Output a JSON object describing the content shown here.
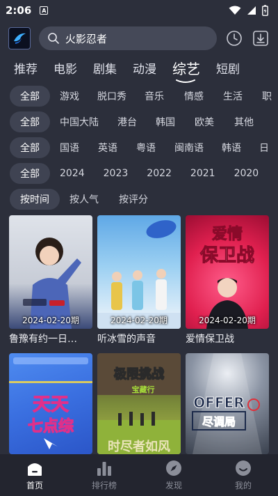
{
  "status": {
    "time": "2:06",
    "a_label": "A"
  },
  "search": {
    "query": "火影忍者"
  },
  "categories": [
    {
      "label": "推荐"
    },
    {
      "label": "电影"
    },
    {
      "label": "剧集"
    },
    {
      "label": "动漫"
    },
    {
      "label": "综艺",
      "active": true
    },
    {
      "label": "短剧"
    }
  ],
  "filters": {
    "type": {
      "selected": "全部",
      "options": [
        "游戏",
        "脱口秀",
        "音乐",
        "情感",
        "生活",
        "职"
      ]
    },
    "region": {
      "selected": "全部",
      "options": [
        "中国大陆",
        "港台",
        "韩国",
        "欧美",
        "其他"
      ]
    },
    "language": {
      "selected": "全部",
      "options": [
        "国语",
        "英语",
        "粤语",
        "闽南语",
        "韩语",
        "日"
      ]
    },
    "year": {
      "selected": "全部",
      "options": [
        "2024",
        "2023",
        "2022",
        "2021",
        "2020"
      ]
    },
    "sort": {
      "selected": "按时间",
      "options": [
        "按人气",
        "按评分"
      ]
    }
  },
  "cards": [
    {
      "title": "鲁豫有约一日…",
      "date": "2024-02-20期",
      "poster_text": ""
    },
    {
      "title": "听冰雪的声音",
      "date": "2024-02-20期",
      "poster_text": ""
    },
    {
      "title": "爱情保卫战",
      "date": "2024-02-20期",
      "poster_text": "爱情 保卫战"
    },
    {
      "title": "",
      "date": "",
      "poster_text": "天天 七点综"
    },
    {
      "title": "",
      "date": "",
      "poster_text": "极限挑战"
    },
    {
      "title": "",
      "date": "",
      "poster_text": "OFFER 尽调局"
    }
  ],
  "nav": [
    {
      "label": "首页",
      "icon": "home-icon",
      "active": true
    },
    {
      "label": "排行榜",
      "icon": "ranking-icon"
    },
    {
      "label": "发现",
      "icon": "discover-icon"
    },
    {
      "label": "我的",
      "icon": "profile-icon"
    }
  ],
  "colors": {
    "background": "#2c2f3b",
    "chip_selected": "#3f4352",
    "nav_bg": "#23252f"
  }
}
